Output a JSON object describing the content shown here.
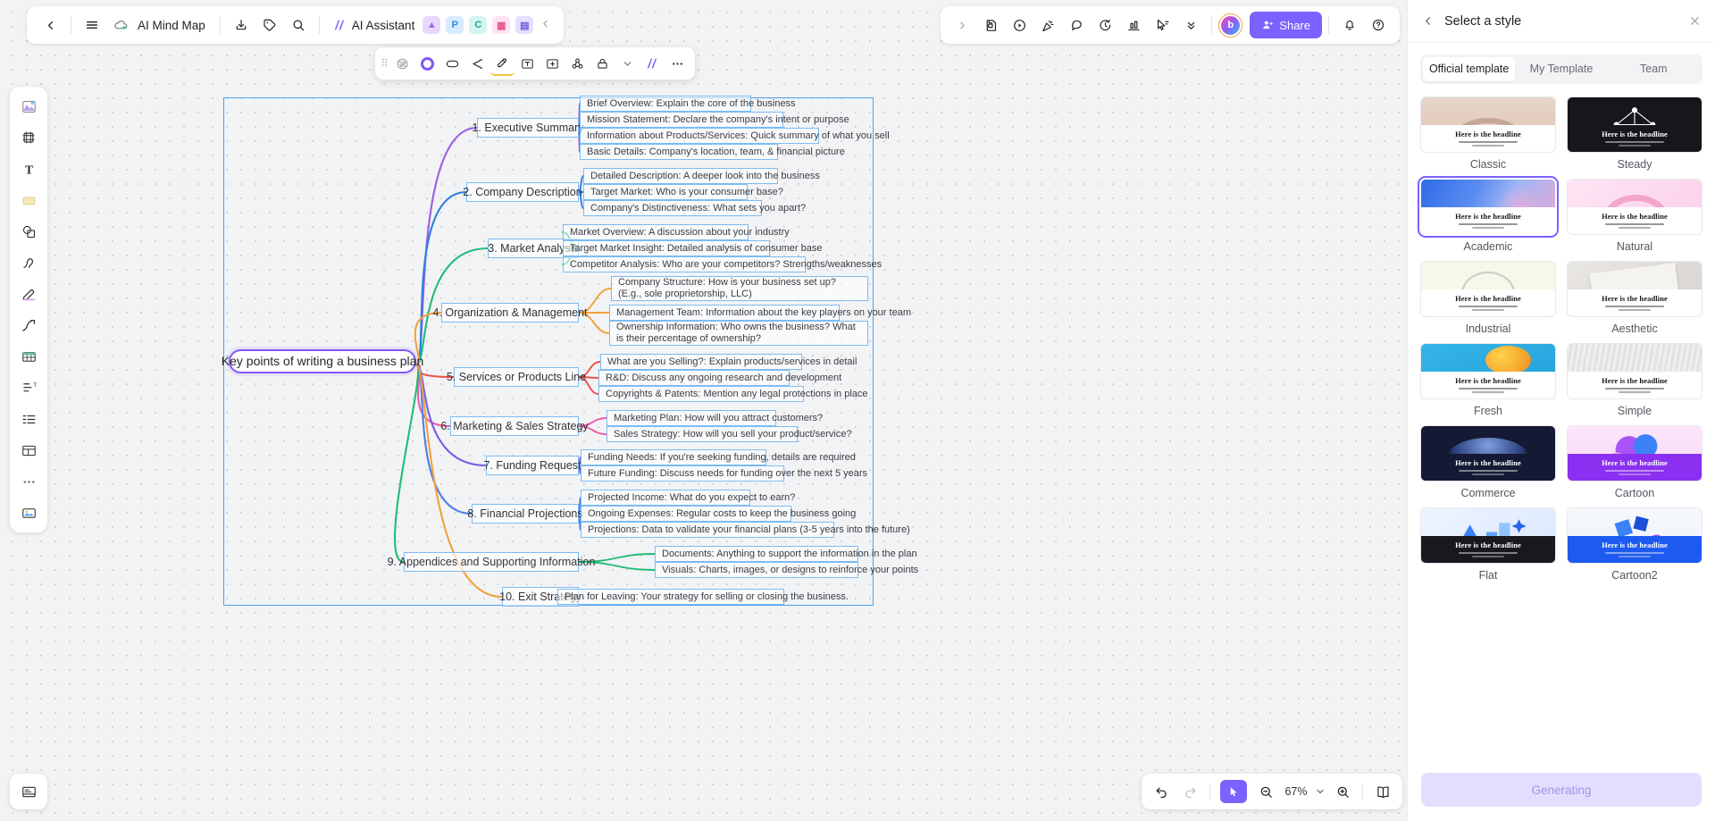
{
  "header": {
    "back_icon": "chevron-left-icon",
    "menu_icon": "hamburger-menu-icon",
    "cloud_icon": "cloud-sync-icon",
    "doc_title": "AI Mind Map",
    "download_icon": "download-icon",
    "tag_icon": "tag-icon",
    "search_icon": "search-icon",
    "ai_assistant_label": "AI Assistant",
    "ai_icon": "ai-sparkle-icon",
    "apps": [
      {
        "name": "image-app-chip",
        "label": "",
        "color": "#e9d8fd"
      },
      {
        "name": "ppt-app-chip",
        "label": "P",
        "color": "#d6ecff"
      },
      {
        "name": "mind-app-chip",
        "label": "",
        "color": "#d3f5ee"
      },
      {
        "name": "grid-app-chip",
        "label": "",
        "color": "#ffe3ef"
      },
      {
        "name": "book-app-chip",
        "label": "",
        "color": "#e5e0ff"
      }
    ],
    "collapse_icon": "chevron-left-icon"
  },
  "header_right": {
    "expand_icon": "chevron-right-icon",
    "tools": [
      {
        "name": "note-icon"
      },
      {
        "name": "play-circle-icon"
      },
      {
        "name": "celebrate-icon"
      },
      {
        "name": "comment-icon"
      },
      {
        "name": "history-icon"
      },
      {
        "name": "chart-icon"
      },
      {
        "name": "cursor-flag-icon"
      }
    ],
    "more_icon": "chevrons-down-icon",
    "avatar_initial": "b",
    "share_label": "Share",
    "share_color": "#7b61ff",
    "bell_icon": "bell-icon",
    "help_icon": "help-circle-icon"
  },
  "node_toolbar": {
    "drag_icon": "drag-handle-icon",
    "items": [
      {
        "name": "theme-circle-icon"
      },
      {
        "name": "color-swatch-icon",
        "color": "#8257f5"
      },
      {
        "name": "shape-icon"
      },
      {
        "name": "branch-style-icon"
      },
      {
        "name": "highlight-icon",
        "active": true
      },
      {
        "name": "text-box-icon"
      },
      {
        "name": "add-node-icon"
      },
      {
        "name": "link-icon"
      },
      {
        "name": "lock-icon"
      },
      {
        "name": "chevron-down-icon"
      },
      {
        "name": "ai-magic-icon"
      },
      {
        "name": "more-horizontal-icon"
      }
    ]
  },
  "side_tools": [
    {
      "name": "magic-wand-icon"
    },
    {
      "name": "emoji-icon"
    },
    {
      "name": "plus-icon"
    },
    {
      "name": "info-icon"
    }
  ],
  "left_rail": [
    {
      "name": "tool-theme-icon"
    },
    {
      "name": "tool-frame-icon"
    },
    {
      "name": "tool-text-icon"
    },
    {
      "name": "tool-sticky-note-icon"
    },
    {
      "name": "tool-shape-icon"
    },
    {
      "name": "tool-pen-icon"
    },
    {
      "name": "tool-highlighter-icon"
    },
    {
      "name": "tool-connector-icon"
    },
    {
      "name": "tool-table-icon"
    },
    {
      "name": "tool-heading-icon"
    },
    {
      "name": "tool-list-icon"
    },
    {
      "name": "tool-layout-icon"
    },
    {
      "name": "tool-more-icon"
    },
    {
      "name": "tool-image-icon"
    }
  ],
  "bottom_bar": {
    "undo_icon": "undo-icon",
    "redo_icon": "redo-icon",
    "present_icon": "cursor-play-icon",
    "zoom_out_icon": "zoom-out-icon",
    "zoom_level": "67%",
    "zoom_chevron_icon": "chevron-down-icon",
    "zoom_in_icon": "zoom-in-icon",
    "outline_icon": "book-outline-icon",
    "left_tool_icon": "layers-panel-icon"
  },
  "panel": {
    "back_icon": "chevron-left-icon",
    "title": "Select a style",
    "close_icon": "close-icon",
    "tabs": [
      {
        "label": "Official template",
        "active": true
      },
      {
        "label": "My Template",
        "active": false
      },
      {
        "label": "Team",
        "active": false
      }
    ],
    "headline_text": "Here is the headline",
    "styles": [
      {
        "name": "Classic",
        "selected": false,
        "art": "classic",
        "dark": false
      },
      {
        "name": "Steady",
        "selected": false,
        "art": "steady",
        "dark": true
      },
      {
        "name": "Academic",
        "selected": true,
        "art": "academic",
        "dark": false
      },
      {
        "name": "Natural",
        "selected": false,
        "art": "natural",
        "dark": false
      },
      {
        "name": "Industrial",
        "selected": false,
        "art": "industrial",
        "dark": false
      },
      {
        "name": "Aesthetic",
        "selected": false,
        "art": "aesthetic",
        "dark": false
      },
      {
        "name": "Fresh",
        "selected": false,
        "art": "fresh",
        "dark": false
      },
      {
        "name": "Simple",
        "selected": false,
        "art": "simple",
        "dark": false
      },
      {
        "name": "Commerce",
        "selected": false,
        "art": "commerce",
        "dark": true
      },
      {
        "name": "Cartoon",
        "selected": false,
        "art": "cartoon",
        "dark": true
      },
      {
        "name": "Flat",
        "selected": false,
        "art": "flat",
        "dark": true
      },
      {
        "name": "Cartoon2",
        "selected": false,
        "art": "cartoon2",
        "dark": true
      }
    ],
    "generate_label": "Generating"
  },
  "mindmap": {
    "root": "Key points of writing a business plan",
    "branches": [
      {
        "topic": "1. Executive Summary",
        "color": "#9b5de5",
        "leaves": [
          "Brief Overview: Explain the core of the business",
          "Mission Statement: Declare the company's intent or purpose",
          "Information about Products/Services: Quick summary of what you sell",
          "Basic Details: Company's location, team, & financial picture"
        ]
      },
      {
        "topic": "2. Company Description",
        "color": "#2b7fe0",
        "leaves": [
          "Detailed Description: A deeper look into the business",
          "Target Market: Who is your consumer base?",
          "Company's Distinctiveness: What sets you apart?"
        ]
      },
      {
        "topic": "3. Market Analysis",
        "color": "#22bb77",
        "leaves": [
          "Market Overview: A discussion about your industry",
          "Target Market Insight: Detailed analysis of consumer base",
          "Competitor Analysis: Who are your competitors? Strengths/weaknesses"
        ]
      },
      {
        "topic": "4. Organization & Management",
        "color": "#f2a13b",
        "leaves": [
          "Company Structure: How is your business set up? (E.g., sole proprietorship, LLC)",
          "Management Team: Information about the key players on your team",
          "Ownership Information: Who owns the business? What is their percentage of ownership?"
        ]
      },
      {
        "topic": "5. Services or Products Line",
        "color": "#f0524a",
        "leaves": [
          "What are you Selling?: Explain products/services in detail",
          "R&D: Discuss any ongoing research and development",
          "Copyrights & Patents: Mention any legal protections in place"
        ]
      },
      {
        "topic": "6. Marketing & Sales Strategy",
        "color": "#f05aa8",
        "leaves": [
          "Marketing Plan: How will you attract customers?",
          "Sales Strategy: How will you sell your product/service?"
        ]
      },
      {
        "topic": "7. Funding Request",
        "color": "#7b5ce5",
        "leaves": [
          "Funding Needs: If you're seeking funding, details are required",
          "Future Funding: Discuss needs for funding over the next 5 years"
        ]
      },
      {
        "topic": "8. Financial Projections",
        "color": "#4f7fe8",
        "leaves": [
          "Projected Income: What do you expect to earn?",
          "Ongoing Expenses: Regular costs to keep the business going",
          "Projections: Data to validate your financial plans (3-5 years into the future)"
        ]
      },
      {
        "topic": "9. Appendices and Supporting Information",
        "color": "#22bb77",
        "leaves": [
          "Documents: Anything to support the information in the plan",
          "Visuals: Charts, images, or designs to reinforce your points"
        ]
      },
      {
        "topic": "10. Exit Strategy",
        "color": "#f2a13b",
        "leaves": [
          "Plan for Leaving: Your strategy for selling or closing the business."
        ]
      }
    ]
  }
}
